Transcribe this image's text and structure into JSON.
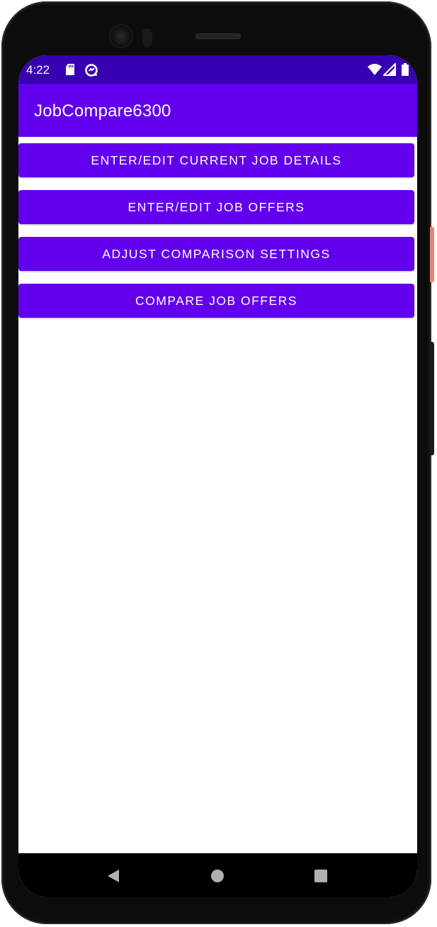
{
  "status_bar": {
    "time": "4:22",
    "icons": [
      "sd-card-icon",
      "data-saver-icon",
      "wifi-icon",
      "signal-icon",
      "battery-icon"
    ],
    "color": "#3700b3"
  },
  "app_bar": {
    "title": "JobCompare6300",
    "color": "#6200ee"
  },
  "main": {
    "buttons": [
      {
        "label": "ENTER/EDIT CURRENT JOB DETAILS"
      },
      {
        "label": "ENTER/EDIT JOB OFFERS"
      },
      {
        "label": "ADJUST COMPARISON SETTINGS"
      },
      {
        "label": "COMPARE JOB OFFERS"
      }
    ]
  },
  "nav_bar": {
    "items": [
      "back-icon",
      "home-icon",
      "recents-icon"
    ]
  }
}
